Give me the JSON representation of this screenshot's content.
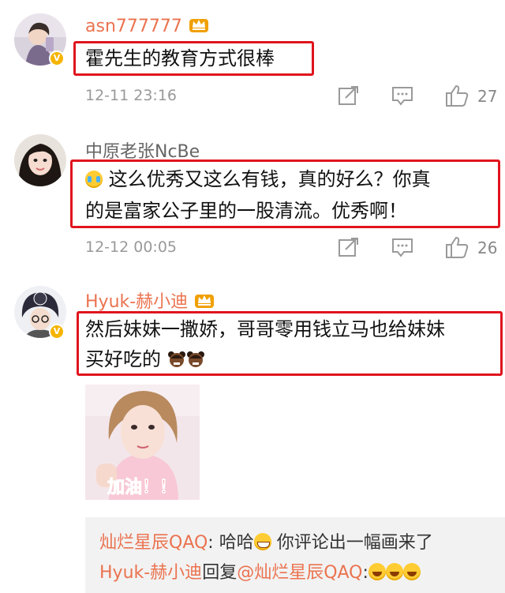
{
  "comments": [
    {
      "username": "asn777777",
      "text_lines": [
        "霍先生的教育方式很棒"
      ],
      "time": "12-11 23:16",
      "likes": "27",
      "verified": true,
      "crown": true
    },
    {
      "username": "中原老张NcBe",
      "text_lines": [
        "这么优秀又这么有钱，真的好么？你真",
        "的是富家公子里的一股清流。优秀啊！"
      ],
      "time": "12-12 00:05",
      "likes": "26",
      "verified": false,
      "crown": false
    },
    {
      "username": "Hyuk-赫小迪",
      "text_lines": [
        "然后妹妹一撒娇，哥哥零用钱立马也给妹妹",
        "买好吃的"
      ],
      "verified": true,
      "crown": true,
      "image_caption": "加油！！"
    }
  ],
  "replies": [
    {
      "author": "灿烂星辰QAQ",
      "sep": ": ",
      "text_a": "哈哈",
      "text_b": " 你评论出一幅画来了"
    },
    {
      "author": "Hyuk-赫小迪",
      "mid": "回复",
      "mention": "@灿烂星辰QAQ",
      "sep": ":"
    }
  ],
  "icons": {
    "repost": "repost-icon",
    "comment": "comment-icon",
    "like": "thumbs-up-icon",
    "crown": "crown-badge-icon",
    "verified": "verified-v-icon"
  },
  "colors": {
    "username_highlight": "#eb7350",
    "border_highlight": "#e0141d",
    "verified_badge": "#f6b400"
  }
}
